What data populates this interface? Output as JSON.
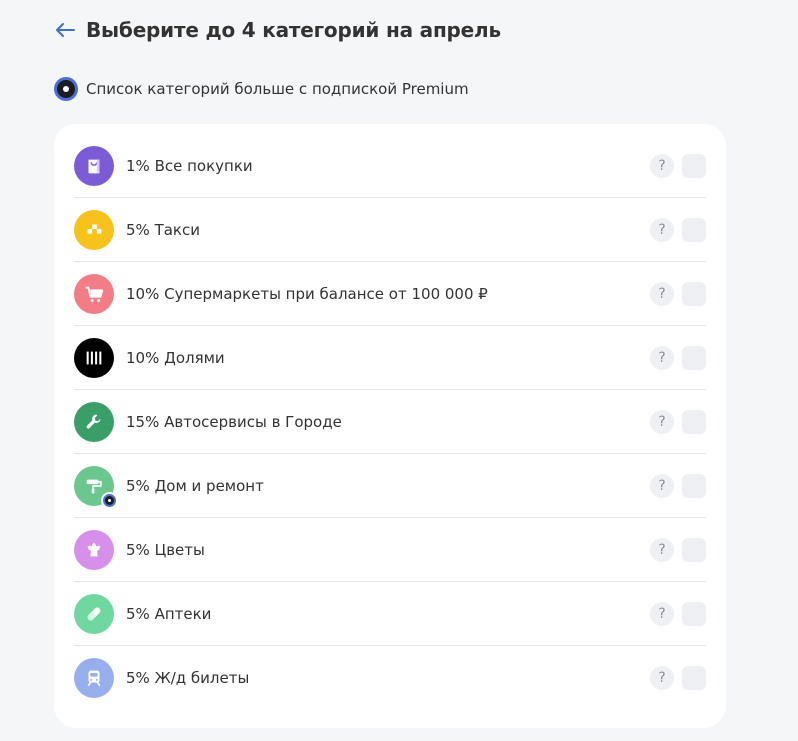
{
  "header": {
    "back_icon": "arrow-left-icon",
    "title": "Выберите до 4 категорий на апрель"
  },
  "premium_note": {
    "icon": "premium-badge-icon",
    "text": "Список категорий больше с подпиской Premium"
  },
  "colors": {
    "accent": "#3b6fd4",
    "premium": "#4b6fd9"
  },
  "categories": [
    {
      "label": "1% Все покупки",
      "icon": "shopping-bag-icon",
      "color": "#7b5cd6",
      "help": "?"
    },
    {
      "label": "5% Такси",
      "icon": "taxi-checker-icon",
      "color": "#f7c21a",
      "help": "?"
    },
    {
      "label": "10% Супермаркеты при балансе от 100 000 ₽",
      "icon": "cart-icon",
      "color": "#f27d86",
      "help": "?"
    },
    {
      "label": "10% Долями",
      "icon": "dolyami-bars-icon",
      "color": "#000000",
      "help": "?"
    },
    {
      "label": "15% Автосервисы в Городе",
      "icon": "wrench-icon",
      "color": "#3a9e69",
      "help": "?"
    },
    {
      "label": "5% Дом и ремонт",
      "icon": "paint-roller-icon",
      "color": "#6bc78e",
      "help": "?",
      "premium": true
    },
    {
      "label": "5% Цветы",
      "icon": "flower-icon",
      "color": "#d690ea",
      "help": "?"
    },
    {
      "label": "5% Аптеки",
      "icon": "pill-icon",
      "color": "#71d7a1",
      "help": "?"
    },
    {
      "label": "5% Ж/д билеты",
      "icon": "train-icon",
      "color": "#98afee",
      "help": "?"
    }
  ]
}
